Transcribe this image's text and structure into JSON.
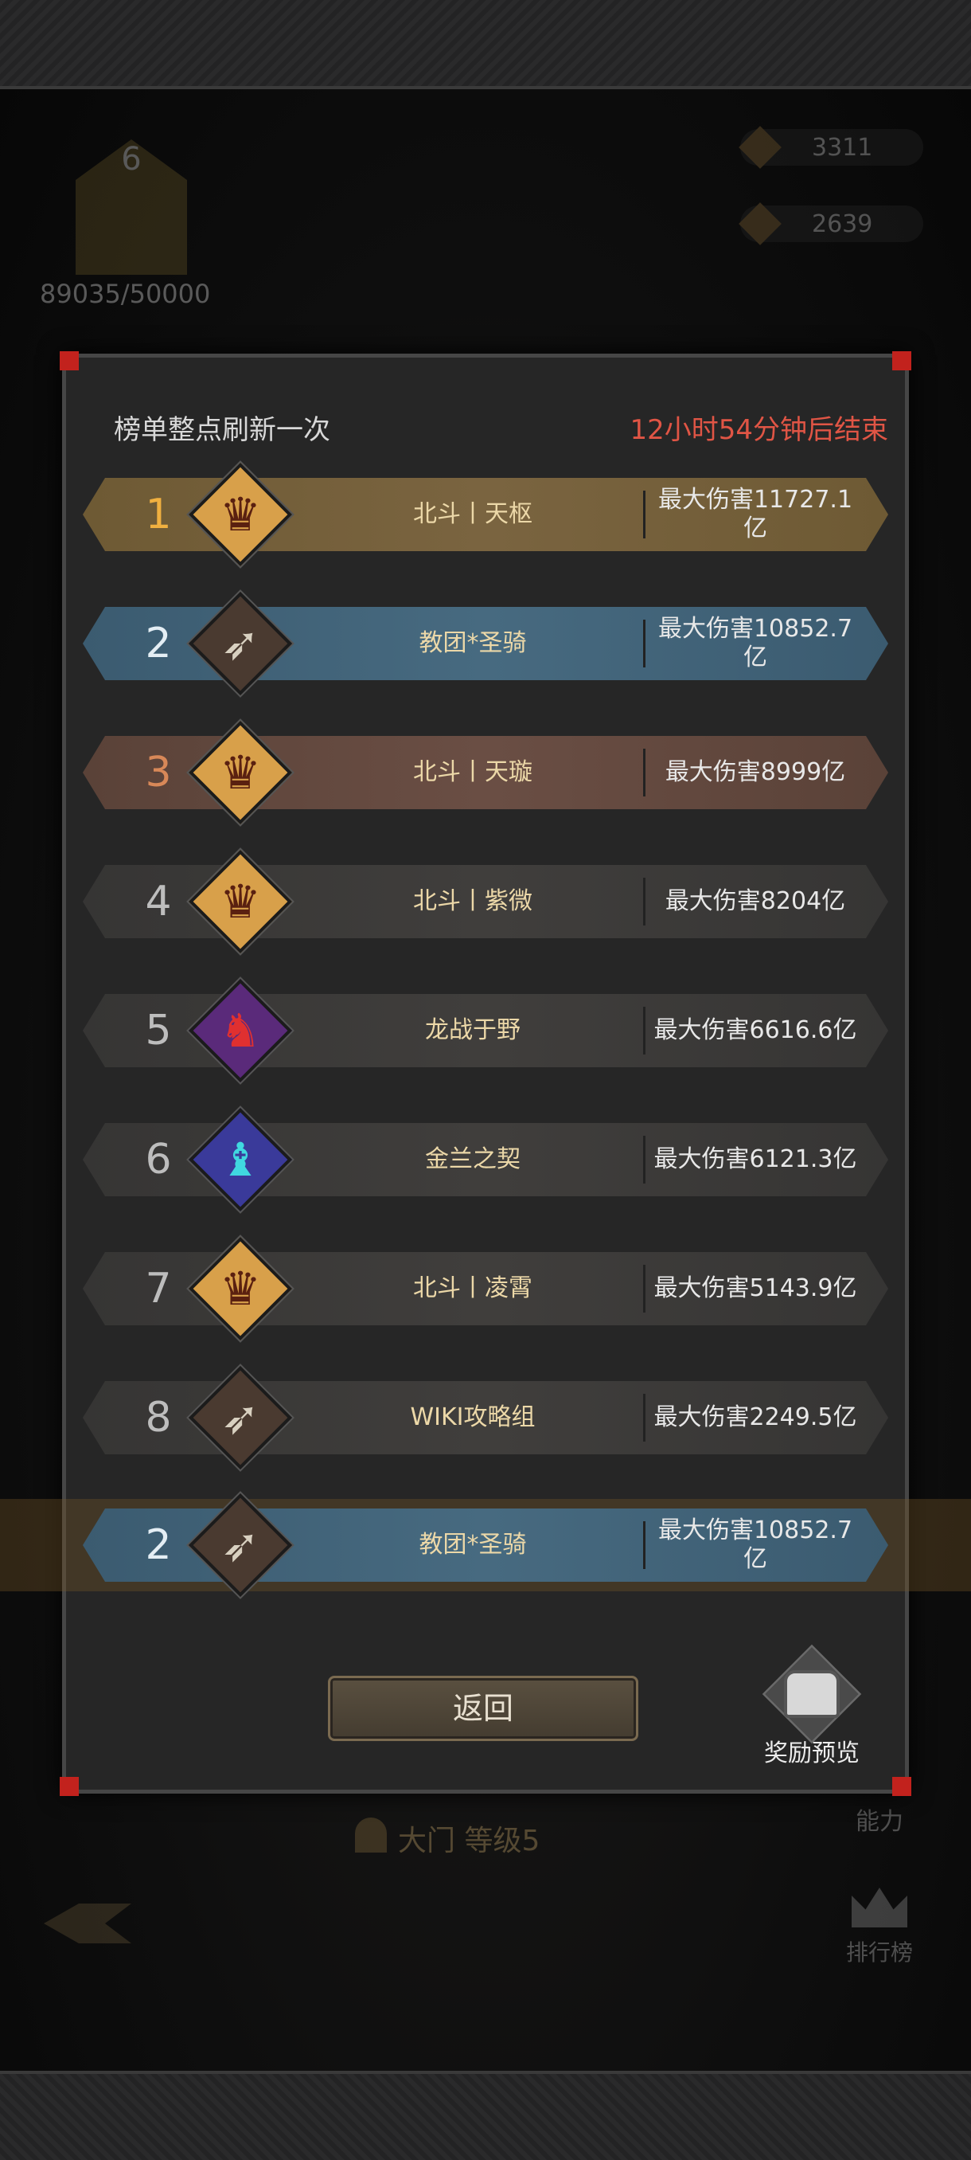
{
  "background": {
    "level": "6",
    "progress_text": "89035/50000",
    "resource_1": "3311",
    "resource_2": "2639",
    "gate_label": "大门  等级5",
    "power_label": "能力",
    "rank_label": "排行榜"
  },
  "dialog": {
    "refresh_text": "榜单整点刷新一次",
    "countdown": "12小时54分钟后结束",
    "rows": [
      {
        "rank": "1",
        "name": "北斗丨天枢",
        "damage": "最大伤害11727.1亿"
      },
      {
        "rank": "2",
        "name": "教团*圣骑",
        "damage": "最大伤害10852.7亿"
      },
      {
        "rank": "3",
        "name": "北斗丨天璇",
        "damage": "最大伤害8999亿"
      },
      {
        "rank": "4",
        "name": "北斗丨紫微",
        "damage": "最大伤害8204亿"
      },
      {
        "rank": "5",
        "name": "龙战于野",
        "damage": "最大伤害6616.6亿"
      },
      {
        "rank": "6",
        "name": "金兰之契",
        "damage": "最大伤害6121.3亿"
      },
      {
        "rank": "7",
        "name": "北斗丨凌霄",
        "damage": "最大伤害5143.9亿"
      },
      {
        "rank": "8",
        "name": "WIKI攻略组",
        "damage": "最大伤害2249.5亿"
      }
    ],
    "my_row": {
      "rank": "2",
      "name": "教团*圣骑",
      "damage": "最大伤害10852.7亿"
    },
    "back_label": "返回",
    "reward_label": "奖励预览"
  }
}
